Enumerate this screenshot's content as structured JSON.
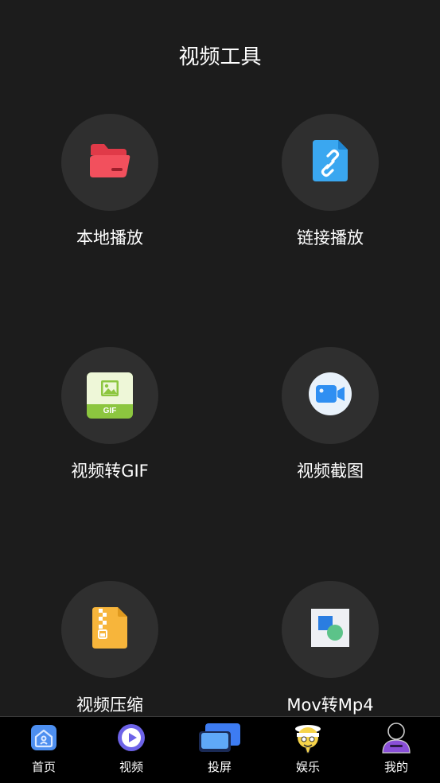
{
  "header": {
    "title": "视频工具"
  },
  "tools": [
    {
      "label": "本地播放",
      "icon": "folder-icon",
      "color": "#f2505d"
    },
    {
      "label": "链接播放",
      "icon": "link-file-icon",
      "color": "#3aa7f0"
    },
    {
      "label": "视频转GIF",
      "icon": "gif-image-icon",
      "color": "#8cc63f"
    },
    {
      "label": "视频截图",
      "icon": "video-camera-icon",
      "color": "#2f8ff2"
    },
    {
      "label": "视频压缩",
      "icon": "zip-file-icon",
      "color": "#f7b53b"
    },
    {
      "label": "Mov转Mp4",
      "icon": "convert-shapes-icon",
      "color": "#2a7de1"
    }
  ],
  "nav": [
    {
      "label": "首页",
      "icon": "home-icon"
    },
    {
      "label": "视频",
      "icon": "play-icon"
    },
    {
      "label": "投屏",
      "icon": "cast-screen-icon"
    },
    {
      "label": "娱乐",
      "icon": "mascot-icon"
    },
    {
      "label": "我的",
      "icon": "profile-icon"
    }
  ],
  "gif_badge": "GIF"
}
